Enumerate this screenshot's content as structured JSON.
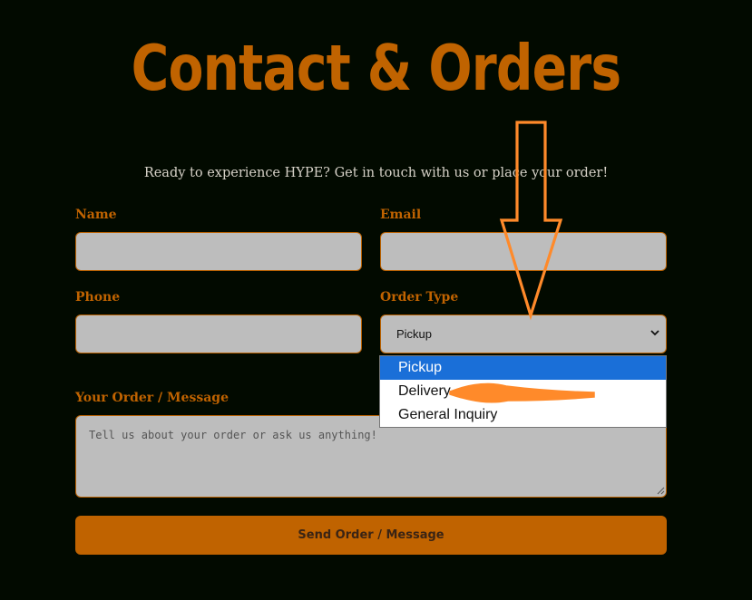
{
  "header": {
    "title": "Contact & Orders",
    "subtitle": "Ready to experience HYPE? Get in touch with us or place your order!"
  },
  "form": {
    "name_label": "Name",
    "email_label": "Email",
    "phone_label": "Phone",
    "order_type_label": "Order Type",
    "order_type_value": "Pickup",
    "order_type_options": [
      "Pickup",
      "Delivery",
      "General Inquiry"
    ],
    "message_label": "Your Order / Message",
    "message_placeholder": "Tell us about your order or ask us anything!",
    "submit_label": "Send Order / Message"
  },
  "icons": {
    "select_arrow": "chevron-down-icon",
    "annotation_arrow": "down-arrow-icon",
    "annotation_pointer": "left-pointer-icon"
  },
  "colors": {
    "background": "#020a00",
    "accent": "#c06300",
    "field_bg": "#bdbdbd",
    "dropdown_highlight": "#1a6fd8",
    "annotation": "#ff8a2a"
  }
}
